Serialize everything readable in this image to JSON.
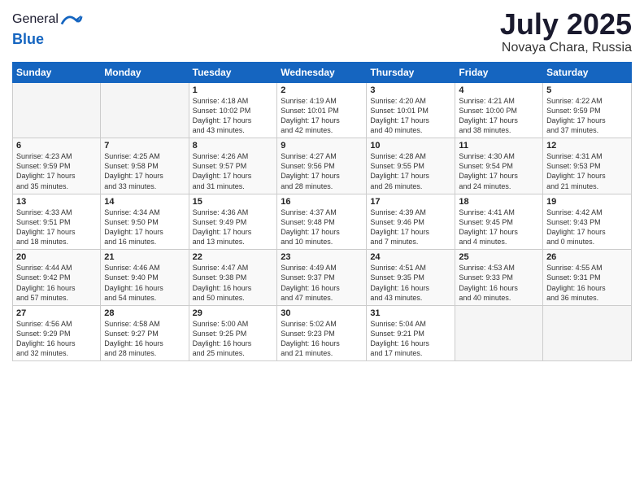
{
  "logo": {
    "general": "General",
    "blue": "Blue"
  },
  "title": {
    "month": "July 2025",
    "location": "Novaya Chara, Russia"
  },
  "days_of_week": [
    "Sunday",
    "Monday",
    "Tuesday",
    "Wednesday",
    "Thursday",
    "Friday",
    "Saturday"
  ],
  "weeks": [
    [
      {
        "day": "",
        "info": ""
      },
      {
        "day": "",
        "info": ""
      },
      {
        "day": "1",
        "info": "Sunrise: 4:18 AM\nSunset: 10:02 PM\nDaylight: 17 hours\nand 43 minutes."
      },
      {
        "day": "2",
        "info": "Sunrise: 4:19 AM\nSunset: 10:01 PM\nDaylight: 17 hours\nand 42 minutes."
      },
      {
        "day": "3",
        "info": "Sunrise: 4:20 AM\nSunset: 10:01 PM\nDaylight: 17 hours\nand 40 minutes."
      },
      {
        "day": "4",
        "info": "Sunrise: 4:21 AM\nSunset: 10:00 PM\nDaylight: 17 hours\nand 38 minutes."
      },
      {
        "day": "5",
        "info": "Sunrise: 4:22 AM\nSunset: 9:59 PM\nDaylight: 17 hours\nand 37 minutes."
      }
    ],
    [
      {
        "day": "6",
        "info": "Sunrise: 4:23 AM\nSunset: 9:59 PM\nDaylight: 17 hours\nand 35 minutes."
      },
      {
        "day": "7",
        "info": "Sunrise: 4:25 AM\nSunset: 9:58 PM\nDaylight: 17 hours\nand 33 minutes."
      },
      {
        "day": "8",
        "info": "Sunrise: 4:26 AM\nSunset: 9:57 PM\nDaylight: 17 hours\nand 31 minutes."
      },
      {
        "day": "9",
        "info": "Sunrise: 4:27 AM\nSunset: 9:56 PM\nDaylight: 17 hours\nand 28 minutes."
      },
      {
        "day": "10",
        "info": "Sunrise: 4:28 AM\nSunset: 9:55 PM\nDaylight: 17 hours\nand 26 minutes."
      },
      {
        "day": "11",
        "info": "Sunrise: 4:30 AM\nSunset: 9:54 PM\nDaylight: 17 hours\nand 24 minutes."
      },
      {
        "day": "12",
        "info": "Sunrise: 4:31 AM\nSunset: 9:53 PM\nDaylight: 17 hours\nand 21 minutes."
      }
    ],
    [
      {
        "day": "13",
        "info": "Sunrise: 4:33 AM\nSunset: 9:51 PM\nDaylight: 17 hours\nand 18 minutes."
      },
      {
        "day": "14",
        "info": "Sunrise: 4:34 AM\nSunset: 9:50 PM\nDaylight: 17 hours\nand 16 minutes."
      },
      {
        "day": "15",
        "info": "Sunrise: 4:36 AM\nSunset: 9:49 PM\nDaylight: 17 hours\nand 13 minutes."
      },
      {
        "day": "16",
        "info": "Sunrise: 4:37 AM\nSunset: 9:48 PM\nDaylight: 17 hours\nand 10 minutes."
      },
      {
        "day": "17",
        "info": "Sunrise: 4:39 AM\nSunset: 9:46 PM\nDaylight: 17 hours\nand 7 minutes."
      },
      {
        "day": "18",
        "info": "Sunrise: 4:41 AM\nSunset: 9:45 PM\nDaylight: 17 hours\nand 4 minutes."
      },
      {
        "day": "19",
        "info": "Sunrise: 4:42 AM\nSunset: 9:43 PM\nDaylight: 17 hours\nand 0 minutes."
      }
    ],
    [
      {
        "day": "20",
        "info": "Sunrise: 4:44 AM\nSunset: 9:42 PM\nDaylight: 16 hours\nand 57 minutes."
      },
      {
        "day": "21",
        "info": "Sunrise: 4:46 AM\nSunset: 9:40 PM\nDaylight: 16 hours\nand 54 minutes."
      },
      {
        "day": "22",
        "info": "Sunrise: 4:47 AM\nSunset: 9:38 PM\nDaylight: 16 hours\nand 50 minutes."
      },
      {
        "day": "23",
        "info": "Sunrise: 4:49 AM\nSunset: 9:37 PM\nDaylight: 16 hours\nand 47 minutes."
      },
      {
        "day": "24",
        "info": "Sunrise: 4:51 AM\nSunset: 9:35 PM\nDaylight: 16 hours\nand 43 minutes."
      },
      {
        "day": "25",
        "info": "Sunrise: 4:53 AM\nSunset: 9:33 PM\nDaylight: 16 hours\nand 40 minutes."
      },
      {
        "day": "26",
        "info": "Sunrise: 4:55 AM\nSunset: 9:31 PM\nDaylight: 16 hours\nand 36 minutes."
      }
    ],
    [
      {
        "day": "27",
        "info": "Sunrise: 4:56 AM\nSunset: 9:29 PM\nDaylight: 16 hours\nand 32 minutes."
      },
      {
        "day": "28",
        "info": "Sunrise: 4:58 AM\nSunset: 9:27 PM\nDaylight: 16 hours\nand 28 minutes."
      },
      {
        "day": "29",
        "info": "Sunrise: 5:00 AM\nSunset: 9:25 PM\nDaylight: 16 hours\nand 25 minutes."
      },
      {
        "day": "30",
        "info": "Sunrise: 5:02 AM\nSunset: 9:23 PM\nDaylight: 16 hours\nand 21 minutes."
      },
      {
        "day": "31",
        "info": "Sunrise: 5:04 AM\nSunset: 9:21 PM\nDaylight: 16 hours\nand 17 minutes."
      },
      {
        "day": "",
        "info": ""
      },
      {
        "day": "",
        "info": ""
      }
    ]
  ]
}
